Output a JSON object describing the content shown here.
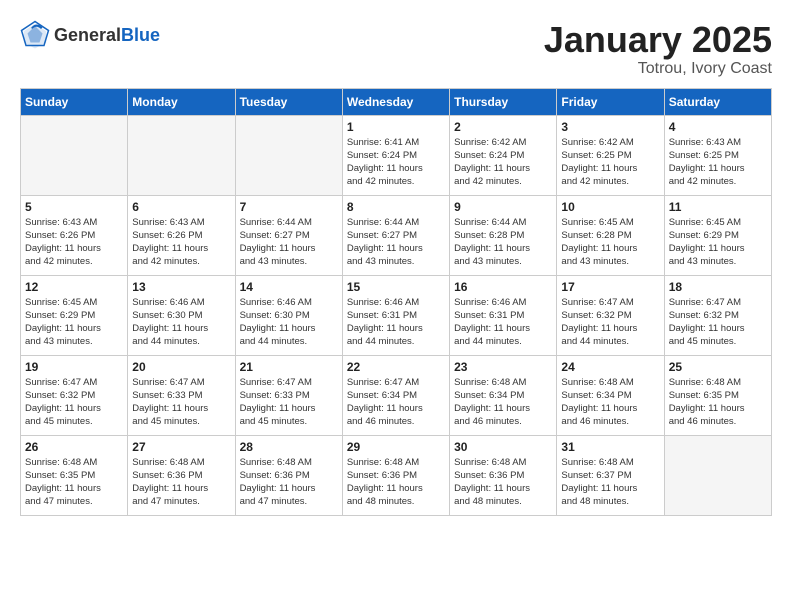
{
  "logo": {
    "general": "General",
    "blue": "Blue"
  },
  "title": "January 2025",
  "subtitle": "Totrou, Ivory Coast",
  "days_of_week": [
    "Sunday",
    "Monday",
    "Tuesday",
    "Wednesday",
    "Thursday",
    "Friday",
    "Saturday"
  ],
  "weeks": [
    [
      {
        "day": "",
        "info": ""
      },
      {
        "day": "",
        "info": ""
      },
      {
        "day": "",
        "info": ""
      },
      {
        "day": "1",
        "info": "Sunrise: 6:41 AM\nSunset: 6:24 PM\nDaylight: 11 hours\nand 42 minutes."
      },
      {
        "day": "2",
        "info": "Sunrise: 6:42 AM\nSunset: 6:24 PM\nDaylight: 11 hours\nand 42 minutes."
      },
      {
        "day": "3",
        "info": "Sunrise: 6:42 AM\nSunset: 6:25 PM\nDaylight: 11 hours\nand 42 minutes."
      },
      {
        "day": "4",
        "info": "Sunrise: 6:43 AM\nSunset: 6:25 PM\nDaylight: 11 hours\nand 42 minutes."
      }
    ],
    [
      {
        "day": "5",
        "info": "Sunrise: 6:43 AM\nSunset: 6:26 PM\nDaylight: 11 hours\nand 42 minutes."
      },
      {
        "day": "6",
        "info": "Sunrise: 6:43 AM\nSunset: 6:26 PM\nDaylight: 11 hours\nand 42 minutes."
      },
      {
        "day": "7",
        "info": "Sunrise: 6:44 AM\nSunset: 6:27 PM\nDaylight: 11 hours\nand 43 minutes."
      },
      {
        "day": "8",
        "info": "Sunrise: 6:44 AM\nSunset: 6:27 PM\nDaylight: 11 hours\nand 43 minutes."
      },
      {
        "day": "9",
        "info": "Sunrise: 6:44 AM\nSunset: 6:28 PM\nDaylight: 11 hours\nand 43 minutes."
      },
      {
        "day": "10",
        "info": "Sunrise: 6:45 AM\nSunset: 6:28 PM\nDaylight: 11 hours\nand 43 minutes."
      },
      {
        "day": "11",
        "info": "Sunrise: 6:45 AM\nSunset: 6:29 PM\nDaylight: 11 hours\nand 43 minutes."
      }
    ],
    [
      {
        "day": "12",
        "info": "Sunrise: 6:45 AM\nSunset: 6:29 PM\nDaylight: 11 hours\nand 43 minutes."
      },
      {
        "day": "13",
        "info": "Sunrise: 6:46 AM\nSunset: 6:30 PM\nDaylight: 11 hours\nand 44 minutes."
      },
      {
        "day": "14",
        "info": "Sunrise: 6:46 AM\nSunset: 6:30 PM\nDaylight: 11 hours\nand 44 minutes."
      },
      {
        "day": "15",
        "info": "Sunrise: 6:46 AM\nSunset: 6:31 PM\nDaylight: 11 hours\nand 44 minutes."
      },
      {
        "day": "16",
        "info": "Sunrise: 6:46 AM\nSunset: 6:31 PM\nDaylight: 11 hours\nand 44 minutes."
      },
      {
        "day": "17",
        "info": "Sunrise: 6:47 AM\nSunset: 6:32 PM\nDaylight: 11 hours\nand 44 minutes."
      },
      {
        "day": "18",
        "info": "Sunrise: 6:47 AM\nSunset: 6:32 PM\nDaylight: 11 hours\nand 45 minutes."
      }
    ],
    [
      {
        "day": "19",
        "info": "Sunrise: 6:47 AM\nSunset: 6:32 PM\nDaylight: 11 hours\nand 45 minutes."
      },
      {
        "day": "20",
        "info": "Sunrise: 6:47 AM\nSunset: 6:33 PM\nDaylight: 11 hours\nand 45 minutes."
      },
      {
        "day": "21",
        "info": "Sunrise: 6:47 AM\nSunset: 6:33 PM\nDaylight: 11 hours\nand 45 minutes."
      },
      {
        "day": "22",
        "info": "Sunrise: 6:47 AM\nSunset: 6:34 PM\nDaylight: 11 hours\nand 46 minutes."
      },
      {
        "day": "23",
        "info": "Sunrise: 6:48 AM\nSunset: 6:34 PM\nDaylight: 11 hours\nand 46 minutes."
      },
      {
        "day": "24",
        "info": "Sunrise: 6:48 AM\nSunset: 6:34 PM\nDaylight: 11 hours\nand 46 minutes."
      },
      {
        "day": "25",
        "info": "Sunrise: 6:48 AM\nSunset: 6:35 PM\nDaylight: 11 hours\nand 46 minutes."
      }
    ],
    [
      {
        "day": "26",
        "info": "Sunrise: 6:48 AM\nSunset: 6:35 PM\nDaylight: 11 hours\nand 47 minutes."
      },
      {
        "day": "27",
        "info": "Sunrise: 6:48 AM\nSunset: 6:36 PM\nDaylight: 11 hours\nand 47 minutes."
      },
      {
        "day": "28",
        "info": "Sunrise: 6:48 AM\nSunset: 6:36 PM\nDaylight: 11 hours\nand 47 minutes."
      },
      {
        "day": "29",
        "info": "Sunrise: 6:48 AM\nSunset: 6:36 PM\nDaylight: 11 hours\nand 48 minutes."
      },
      {
        "day": "30",
        "info": "Sunrise: 6:48 AM\nSunset: 6:36 PM\nDaylight: 11 hours\nand 48 minutes."
      },
      {
        "day": "31",
        "info": "Sunrise: 6:48 AM\nSunset: 6:37 PM\nDaylight: 11 hours\nand 48 minutes."
      },
      {
        "day": "",
        "info": ""
      }
    ]
  ]
}
